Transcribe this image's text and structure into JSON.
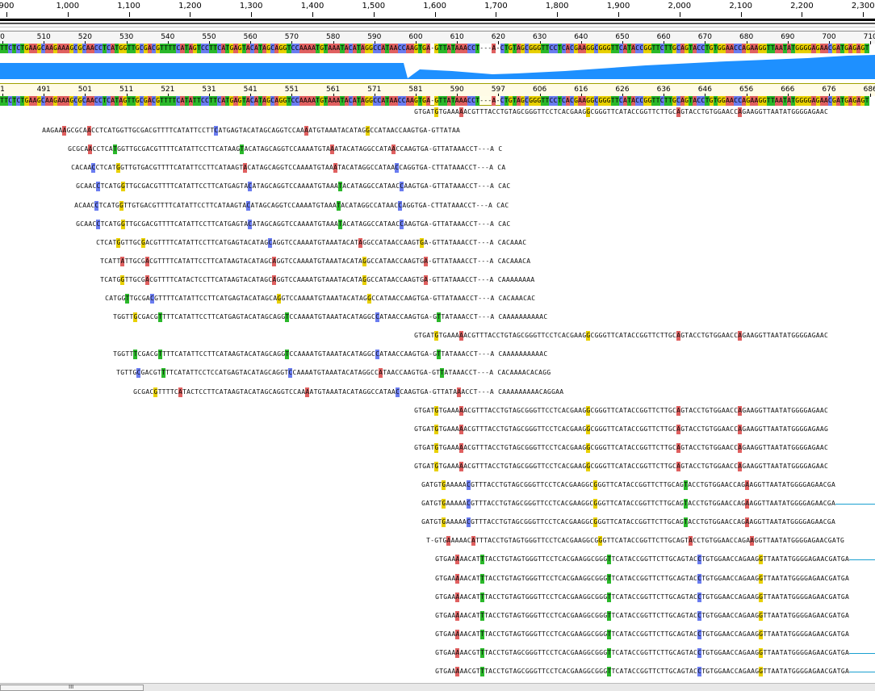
{
  "overview_ruler": {
    "labels": [
      "900",
      "1,000",
      "1,100",
      "1,200",
      "1,300",
      "1,400",
      "1,500",
      "1,600",
      "1,700",
      "1,800",
      "1,900",
      "2,000",
      "2,100",
      "2,200",
      "2,300"
    ],
    "start": 900,
    "step": 100
  },
  "consensus_ruler": {
    "labels": [
      "0",
      "510",
      "520",
      "530",
      "540",
      "550",
      "560",
      "570",
      "580",
      "590",
      "600",
      "610",
      "620",
      "630",
      "640",
      "650",
      "660",
      "670",
      "680",
      "690",
      "700",
      "710"
    ]
  },
  "consensus_sequence": "TTCTCTGAAGCAAGAAAGCGCAACCTCATGGTTGCGACGTTTTCATAGTCCTTCATGAGTACATAGCAGGTCCAAAATGTAAATACATAGGCCATAACCAAGTGA-GTTATAAACCT---A-CTGTAGCGGGTTCCTCACGAAGGCGGGTTCATACCGGTTCTTGCAGTACCTGTGGAACCAGAAGGTTAATATGGGGAGAACGATGAGAGT",
  "coverage": {
    "color": "#1e90ff"
  },
  "reference_ruler": {
    "labels": [
      "1",
      "491",
      "501",
      "511",
      "521",
      "531",
      "541",
      "551",
      "561",
      "571",
      "581",
      "590",
      "597",
      "606",
      "616",
      "626",
      "636",
      "646",
      "656",
      "666",
      "676",
      "686"
    ]
  },
  "reference_sequence": "TTCTCTGAAGCAAGAAAGCGCAACCTCATAGTTGCGACGTTTTCATATTCCTTCATGAGTACATAGCAGGTCCAAAATGTAAATACATAGGCCATAACCAAGTGA-GTTATAAACCT---A-CTGTAGCGGGTTCCTCACGAAGGCGGGTTCATACCGGTTCTTGCAGTACCTGTGGAACCAGAAGGTTAATATGGGGAGAACGATGAGAGT",
  "reads": [
    {
      "seq": "GTGATGTGAAAAACGTTTACCTGTAGCGGGTTCCTCACGAAGGCGGGTTCATACCGGTTCTTGCAGTACCTGTGGAACCAGAAGGTTAATATGGGGAGAAC",
      "start": 513,
      "tail": false
    },
    {
      "seq": "AAGAAAGCGCAACCTCATGGTTGCGACGTTTTCATATTCCTTCATGAGTACATAGCAGGTCCAAAATGTAAATACATAGGCCATAACCAAGTGA-GTTATAA",
      "start": 52,
      "tail": false
    },
    {
      "seq": "GCGCAACCTCATGGTTGCGACGTTTTCATATTCCTTCATAAGTACATAGCAGGTCCAAAATGTAAATACATAGGCCATAACCAAGTGA-GTTATAAACCT---A C",
      "start": 84,
      "tail": false
    },
    {
      "seq": "CACAACCTCATGGTTGTGACGTTTTCATATTCCTTCATAAGTACATAGCAGGTCCAAAATGTAAATACATAGGCCATAACCAGGTGA-CTTATAAACCT---A CA",
      "start": 88,
      "tail": false
    },
    {
      "seq": "GCAACCTCATGGTTGCGACGTTTTCATATTCCTTCATGAGTACATAGCAGGTCCAAAATGTAAATACATAGGCCATAACCAAGTGA-GTTATAAACCT---A CAC",
      "start": 94,
      "tail": false
    },
    {
      "seq": "ACAACCTCATGGTTGTGACGTTTTCATATTCCTTCATAAGTACATAGCAGGTCCAAAATGTAAATACATAGGCCATAACCAGGTGA-CTTATAAACCT---A CAC",
      "start": 92,
      "tail": false
    },
    {
      "seq": "GCAACCTCATGGTTGCGACGTTTTCATATTCCTTCATGAGTACATAGCAGGTCCAAAATGTAAATACATAGGCCATAACCAAGTGA-GTTATAAACCT---A CAC",
      "start": 94,
      "tail": false
    },
    {
      "seq": "CTCATGGTTGCGACGTTTTCATATTCCTTCATGAGTACATAGCAGGTCCAAAATGTAAATACATAGGCCATAACCAAGTGA-GTTATAAACCT---A CACAAAC",
      "start": 119,
      "tail": false
    },
    {
      "seq": "TCATTATTGCGACGTTTTCATATTCCTTCATAAGTACATAGCAGGTCCAAAATGTAAATACATAGGCCATAACCAAGTGA-GTTATAAACCT---A CACAAACA",
      "start": 124,
      "tail": false
    },
    {
      "seq": "TCATGGTTGCGACGTTTTCATACTCCTTCATAAGTACATAGCAGGTCCAAAATGTAAATACATAGGCCATAACCAAGTGA-GTTATAAACCT---A CAAAAAAAA",
      "start": 124,
      "tail": false
    },
    {
      "seq": "CATGGTTGCGACGTTTTCATATTCCTTCATGAGTACATAGCAGGTCCAAAATGTAAATACATAGGCCATAACCAAGTGA-GTTATAAACCT---A CACAAACAC",
      "start": 130,
      "tail": false
    },
    {
      "seq": "TGGTTGCGACGTTTTCATATTCCTTCATGAGTACATAGCAGGTCCAAAATGTAAATACATAGGCCATAACCAAGTGA-GTTATAAACCT---A CAAAAAAAAAAC",
      "start": 140,
      "tail": false
    },
    {
      "seq": "GTGATGTGAAAAACGTTTACCTGTAGCGGGTTCCTCACGAAGGCGGGTTCATACCGGTTCTTGCAGTACCTGTGGAACCAGAAGGTTAATATGGGGAGAAC",
      "start": 513,
      "tail": false
    },
    {
      "seq": "TGGTTTCGACGTTTTCATATTCCTTCATAAGTACATAGCAGGTCCAAAATGTAAATACATAGGCCATAACCAAGTGA-GTTATAAACCT---A CAAAAAAAAAAC",
      "start": 140,
      "tail": false
    },
    {
      "seq": "TGTTGCGACGTTTTCATATTCCTCCATGAGTACATAGCAGGTCCAAAATGTAAATACATAGGCCATAACCAAGTGA-GTTATAAACCT---A CACAAAACACAGG",
      "start": 144,
      "tail": false
    },
    {
      "seq": "GCGACGTTTTCATACTCCTTCATAAGTACATAGCAGGTCCAAAATGTAAATACATAGGCCATAACCAAGTGA-GTTATAAACCT---A CAAAAAAAAACAGGAA",
      "start": 165,
      "tail": false
    },
    {
      "seq": "GTGATGTGAAAAACGTTTACCTGTAGCGGGTTCCTCACGAAGGCGGGTTCATACCGGTTCTTGCAGTACCTGTGGAACCAGAAGGTTAATATGGGGAGAAC",
      "start": 513,
      "tail": false
    },
    {
      "seq": "GTGATGTGAAAAACGTTTACCTGTAGCGGGTTCCTCACGAAGGCGGGTTCATACCGGTTCTTGCAGTACCTGTGGAACCAGAAGGTTAATATGGGGAGAAG",
      "start": 513,
      "tail": false
    },
    {
      "seq": "GTGATGTGAAAAACGTTTACCTGTAGCGGGTTCCTCACGAAGGCGGGTTCATACCGGTTCTTGCAGTACCTGTGGAACCAGAAGGTTAATATGGGGAGAAC",
      "start": 513,
      "tail": false
    },
    {
      "seq": "GTGATGTGAAAAACGTTTACCTGTAGCGGGTTCCTCACGAAGGCGGGTTCATACCGGTTCTTGCAGTACCTGTGGAACCAGAAGGTTAATATGGGGAGAAC",
      "start": 513,
      "tail": false
    },
    {
      "seq": "GATGTGAAAAACGTTTACCTGTAGCGGGTTCCTCACGAAGGCGGGTTCATACCGGTTCTTGCAGTACCTGTGGAACCAGAAGGTTAATATGGGGAGAACGA",
      "start": 522,
      "tail": false
    },
    {
      "seq": "GATGTGAAAAACGTTTACCTGTAGCGGGTTCCTCACGAAGGCGGGTTCATACCGGTTCTTGCAGTACCTGTGGAACCAGAAGGTTAATATGGGGAGAACGA",
      "start": 522,
      "tail": true
    },
    {
      "seq": "GATGTGAAAAACGTTTACCTGTAGCGGGTTCCTCACGAAGGCGGGTTCATACCGGTTCTTGCAGTACCTGTGGAACCAGAAGGTTAATATGGGGAGAACGA",
      "start": 522,
      "tail": false
    },
    {
      "seq": "T-GTGAAAAACATTTACCTGTAGTGGGTTCCTCACGAAGGCGGGTTCATACCGGTTCTTGCAGTACCTGTGGAACCAGAAGGTTAATATGGGGAGAACGATG",
      "start": 528,
      "tail": false
    },
    {
      "seq": "GTGAAAAACATTTACCTGTAGTGGGTTCCTCACGAAGGCGGGTTCATACCGGTTCTTGCAGTACCTGTGGAACCAGAAGGTTAATATGGGGAGAACGATGA",
      "start": 539,
      "tail": true
    },
    {
      "seq": "GTGAAAAACATTTACCTGTAGTGGGTTCCTCACGAAGGCGGGTTCATACCGGTTCTTGCAGTACCTGTGGAACCAGAAGGTTAATATGGGGAGAACGATGA",
      "start": 539,
      "tail": false
    },
    {
      "seq": "GTGAAAAACATTTACCTGTAGTGGGTTCCTCACGAAGGCGGGTTCATACCGGTTCTTGCAGTACCTGTGGAACCAGAAGGTTAATATGGGGAGAACGATGA",
      "start": 539,
      "tail": false
    },
    {
      "seq": "GTGAAAAACATTTACCTGTAGTGGGTTCCTCACGAAGGCGGGTTCATACCGGTTCTTGCAGTACCTGTGGAACCAGAAGGTTAATATGGGGAGAACGATGA",
      "start": 539,
      "tail": false
    },
    {
      "seq": "GTGAAAAACATTTACCTGTAGTGGGTTCCTCACGAAGGCGGGTTCATACCGGTTCTTGCAGTACCTGTGGAACCAGAAGGTTAATATGGGGAGAACGATGA",
      "start": 539,
      "tail": false
    },
    {
      "seq": "GTGAAAAACGTTTACCTGTAGCGGGTTCCTCACGAAGGCGGGTTCATACCGGTTCTTGCAGTACCTGTGGAACCAGAAGGTTAATATGGGGAGAACGATGA",
      "start": 539,
      "tail": true
    },
    {
      "seq": "GTGAAAAACGTTTACCTGTAGCGGGTTCCTCACGAAGGCGGGTTCATACCGGTTCTTGCAGTACCTGTGGAACCAGAAGGTTAATATGGGGAGAACGATGA",
      "start": 539,
      "tail": true
    }
  ],
  "colors": {
    "A": "#e06060",
    "G": "#e8d000",
    "T": "#2ab82a",
    "C": "#6a7cf0",
    "tail": "#1aa0d0"
  },
  "scrollbar": {
    "grip": "III"
  }
}
